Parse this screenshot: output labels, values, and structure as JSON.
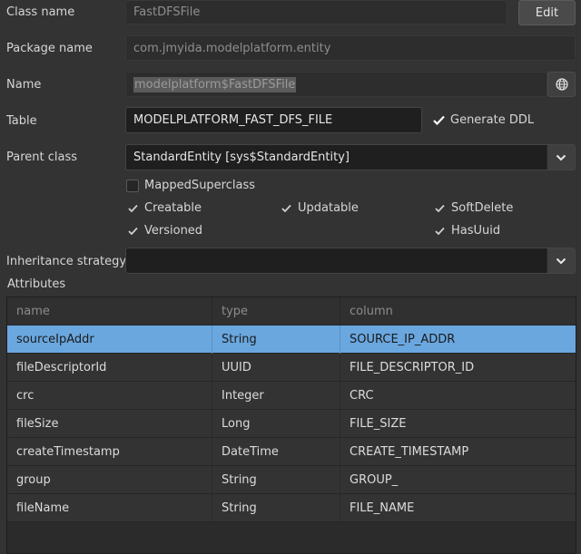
{
  "form": {
    "class_name": {
      "label": "Class name",
      "value": "FastDFSFile",
      "edit_label": "Edit"
    },
    "package_name": {
      "label": "Package name",
      "value": "com.jmyida.modelplatform.entity"
    },
    "name": {
      "label": "Name",
      "value": "modelplatform$FastDFSFile"
    },
    "table": {
      "label": "Table",
      "value": "MODELPLATFORM_FAST_DFS_FILE",
      "generate_ddl_label": "Generate DDL",
      "generate_ddl_checked": true
    },
    "parent_class": {
      "label": "Parent class",
      "value": "StandardEntity [sys$StandardEntity]"
    },
    "checkboxes": {
      "mapped_superclass": {
        "label": "MappedSuperclass",
        "checked": false
      },
      "creatable": {
        "label": "Creatable",
        "checked": true
      },
      "updatable": {
        "label": "Updatable",
        "checked": true
      },
      "soft_delete": {
        "label": "SoftDelete",
        "checked": true
      },
      "versioned": {
        "label": "Versioned",
        "checked": true
      },
      "has_uuid": {
        "label": "HasUuid",
        "checked": true
      }
    },
    "inheritance_strategy": {
      "label": "Inheritance strategy",
      "value": ""
    }
  },
  "attributes": {
    "title": "Attributes",
    "columns": [
      "name",
      "type",
      "column"
    ],
    "rows": [
      {
        "name": "sourceIpAddr",
        "type": "String",
        "column": "SOURCE_IP_ADDR",
        "selected": true
      },
      {
        "name": "fileDescriptorId",
        "type": "UUID",
        "column": "FILE_DESCRIPTOR_ID"
      },
      {
        "name": "crc",
        "type": "Integer",
        "column": "CRC"
      },
      {
        "name": "fileSize",
        "type": "Long",
        "column": "FILE_SIZE"
      },
      {
        "name": "createTimestamp",
        "type": "DateTime",
        "column": "CREATE_TIMESTAMP"
      },
      {
        "name": "group",
        "type": "String",
        "column": "GROUP_"
      },
      {
        "name": "fileName",
        "type": "String",
        "column": "FILE_NAME"
      }
    ]
  },
  "icons": {
    "globe": "globe-icon",
    "chevron": "chevron-down-icon",
    "check": "check-icon"
  },
  "colors": {
    "background": "#333333",
    "selection": "#6aa7df"
  }
}
